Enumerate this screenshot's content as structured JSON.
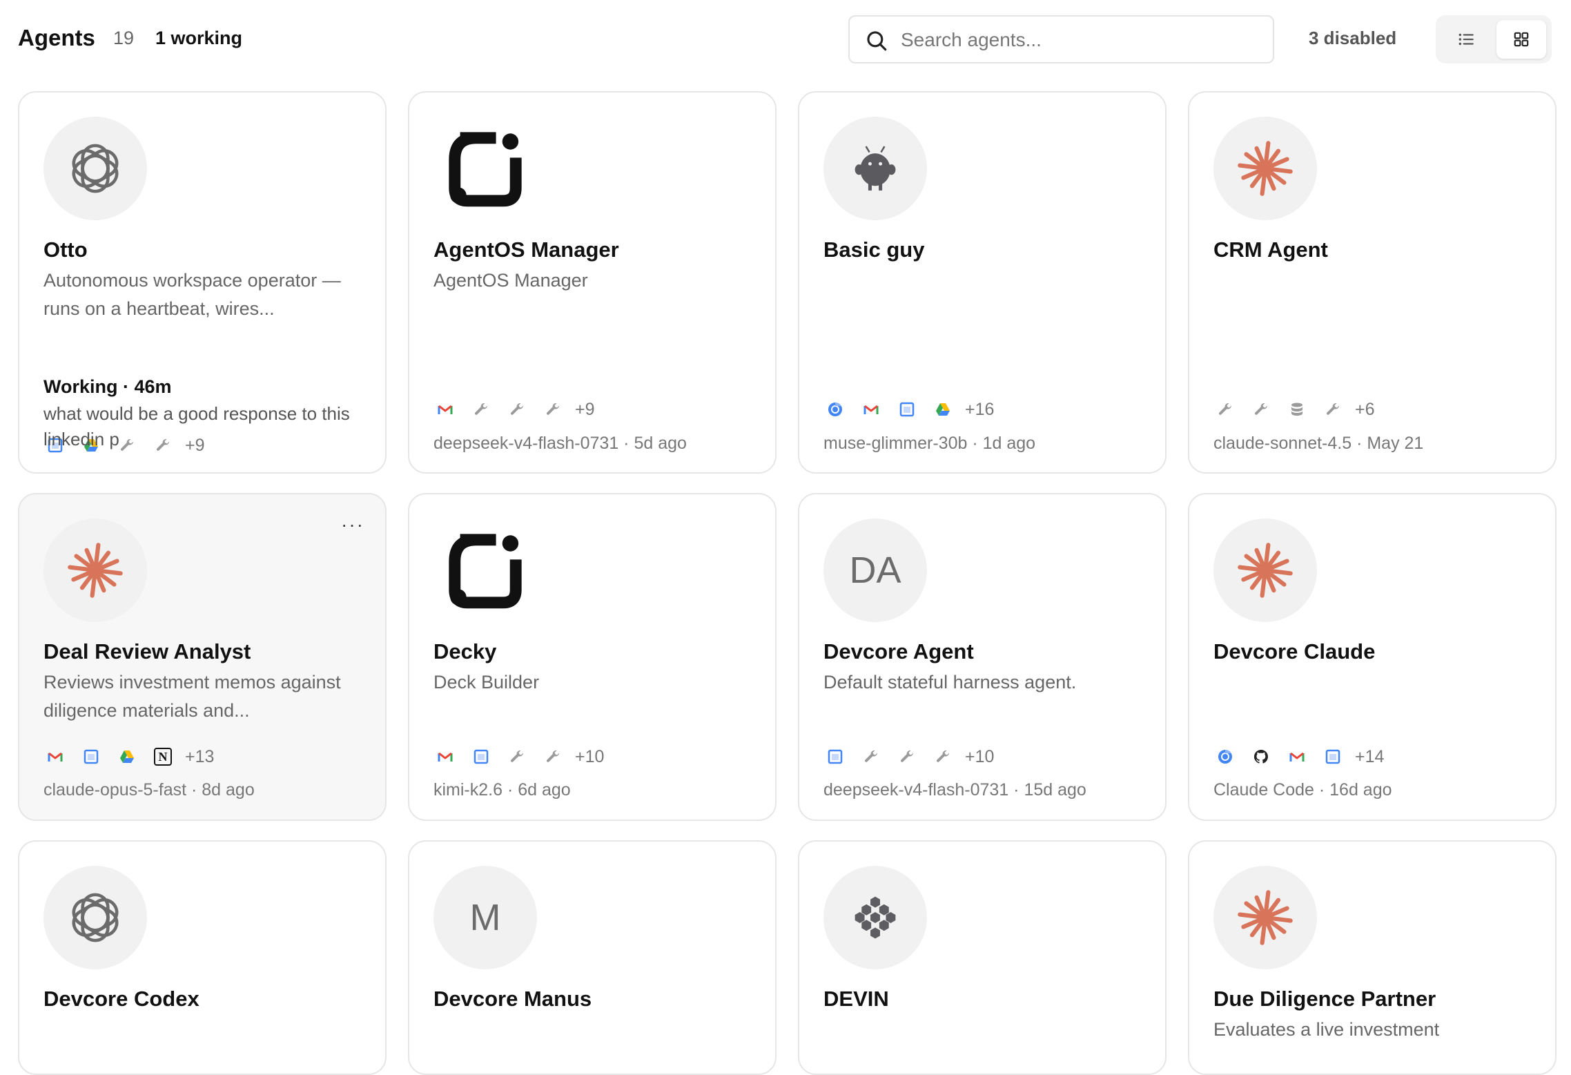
{
  "header": {
    "title": "Agents",
    "count": "19",
    "working": "1 working",
    "search_placeholder": "Search agents...",
    "disabled": "3 disabled"
  },
  "colors": {
    "claude": "#d8745a",
    "avatar_bg": "#f1f1f1",
    "border": "#e6e6e6"
  },
  "agents": [
    {
      "name": "Otto",
      "avatar": "openai-icon",
      "description": "Autonomous workspace operator — runs on a heartbeat, wires...",
      "tools": [
        "calendar-icon",
        "drive-icon",
        "wrench-icon",
        "wrench-icon"
      ],
      "more": "+9",
      "status": "Working · 46m",
      "last_message": "what would be a good response to this linkedin p"
    },
    {
      "name": "AgentOS Manager",
      "avatar": "agentos-logo-icon",
      "description": "AgentOS Manager",
      "tools": [
        "gmail-icon",
        "wrench-icon",
        "wrench-icon",
        "wrench-icon"
      ],
      "more": "+9",
      "meta": "deepseek-v4-flash-0731 · 5d ago"
    },
    {
      "name": "Basic guy",
      "avatar": "robot-icon",
      "description": "",
      "tools": [
        "chrome-icon",
        "gmail-icon",
        "calendar-icon",
        "drive-icon"
      ],
      "more": "+16",
      "meta": "muse-glimmer-30b · 1d ago"
    },
    {
      "name": "CRM Agent",
      "avatar": "claude-icon",
      "description": "",
      "tools": [
        "wrench-icon",
        "wrench-icon",
        "database-icon",
        "wrench-icon"
      ],
      "more": "+6",
      "meta": "claude-sonnet-4.5 · May 21"
    },
    {
      "name": "Deal Review Analyst",
      "avatar": "claude-icon",
      "description": "Reviews investment memos against diligence materials and...",
      "tools": [
        "gmail-icon",
        "calendar-icon",
        "drive-icon",
        "notion-icon"
      ],
      "more": "+13",
      "meta": "claude-opus-5-fast · 8d ago",
      "menu": "···"
    },
    {
      "name": "Decky",
      "avatar": "agentos-logo-icon",
      "description": "Deck Builder",
      "tools": [
        "gmail-icon",
        "calendar-icon",
        "wrench-icon",
        "wrench-icon"
      ],
      "more": "+10",
      "meta": "kimi-k2.6 · 6d ago"
    },
    {
      "name": "Devcore Agent",
      "avatar": "initials",
      "initials": "DA",
      "description": "Default stateful harness agent.",
      "tools": [
        "calendar-icon",
        "wrench-icon",
        "wrench-icon",
        "wrench-icon"
      ],
      "more": "+10",
      "meta": "deepseek-v4-flash-0731 · 15d ago"
    },
    {
      "name": "Devcore Claude",
      "avatar": "claude-icon",
      "description": "",
      "tools": [
        "chrome-icon",
        "github-icon",
        "gmail-icon",
        "calendar-icon"
      ],
      "more": "+14",
      "meta": "Claude Code · 16d ago"
    },
    {
      "name": "Devcore Codex",
      "avatar": "openai-icon",
      "description": ""
    },
    {
      "name": "Devcore Manus",
      "avatar": "initials",
      "initials": "M",
      "description": ""
    },
    {
      "name": "DEVIN",
      "avatar": "devin-icon",
      "description": ""
    },
    {
      "name": "Due Diligence Partner",
      "avatar": "claude-icon",
      "description": "Evaluates a live investment"
    }
  ]
}
